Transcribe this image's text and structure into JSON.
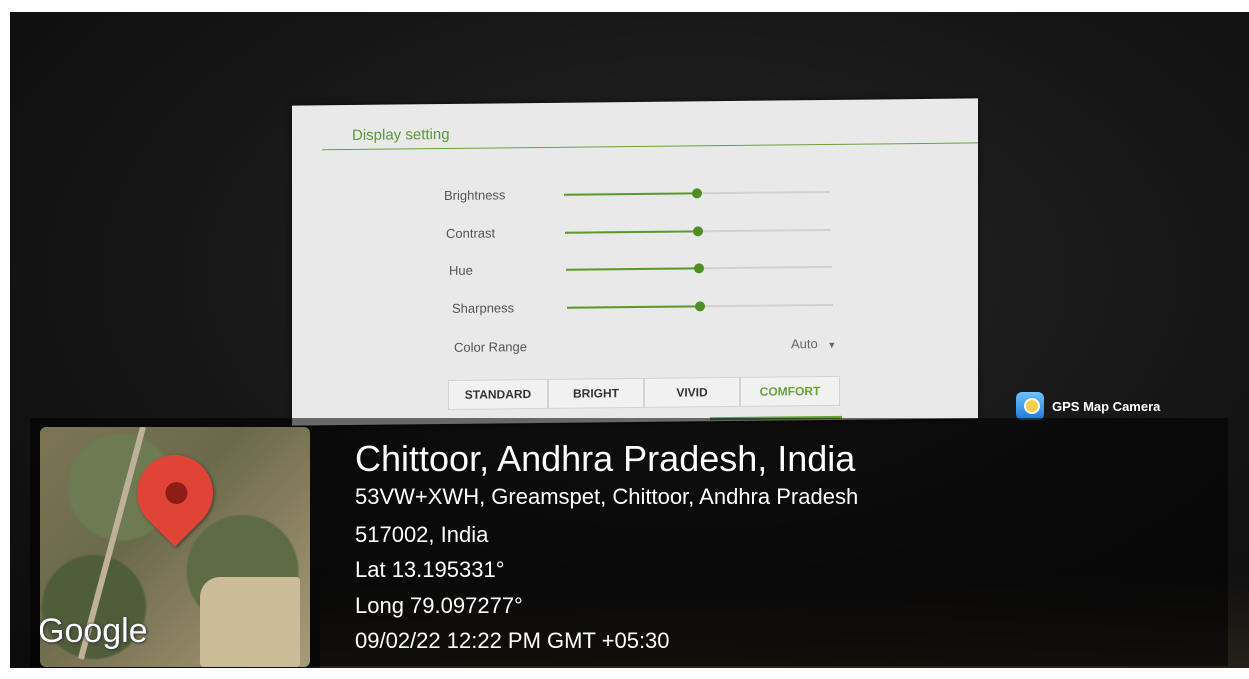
{
  "screen": {
    "title": "Display setting",
    "settings": [
      {
        "label": "Brightness",
        "value": 50
      },
      {
        "label": "Contrast",
        "value": 50
      },
      {
        "label": "Hue",
        "value": 50
      },
      {
        "label": "Sharpness",
        "value": 50
      }
    ],
    "color_range": {
      "label": "Color Range",
      "value": "Auto"
    },
    "modes": [
      "STANDARD",
      "BRIGHT",
      "VIVID",
      "COMFORT"
    ],
    "active_mode": "COMFORT",
    "accent": "#5a9a2f"
  },
  "watermark": {
    "app_name": "GPS Map Camera",
    "map_brand": "Google",
    "location_title": "Chittoor, Andhra Pradesh, India",
    "address_line1": "53VW+XWH, Greamspet, Chittoor, Andhra Pradesh",
    "address_line2": "517002, India",
    "lat": "Lat 13.195331°",
    "long": "Long 79.097277°",
    "datetime": "09/02/22 12:22 PM GMT +05:30"
  }
}
